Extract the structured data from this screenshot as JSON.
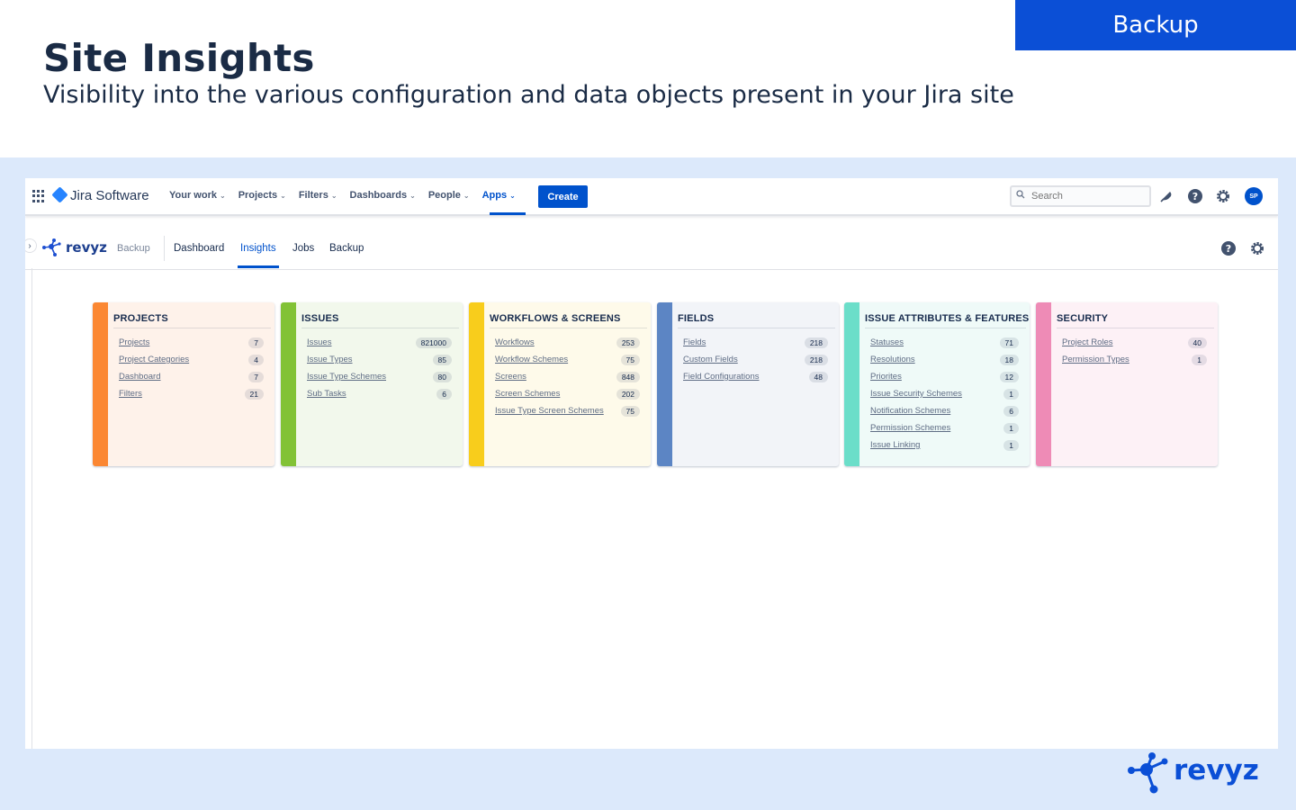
{
  "slide": {
    "title": "Site Insights",
    "subtitle": "Visibility into the various configuration and data objects present in your Jira site",
    "badge": "Backup",
    "brand": "revyz"
  },
  "colors": {
    "accent_blue": "#0b4fd6",
    "jira_blue": "#0052cc",
    "band": "#dce9fb"
  },
  "jira_nav": {
    "product": "Jira Software",
    "items": [
      {
        "label": "Your work"
      },
      {
        "label": "Projects"
      },
      {
        "label": "Filters"
      },
      {
        "label": "Dashboards"
      },
      {
        "label": "People"
      },
      {
        "label": "Apps"
      }
    ],
    "create_label": "Create",
    "search_placeholder": "Search",
    "avatar_initials": "SP",
    "icons": [
      "app-switcher-icon",
      "notifications-icon",
      "help-icon",
      "settings-icon"
    ]
  },
  "app_nav": {
    "logo_text": "revyz",
    "app_label": "Backup",
    "tabs": [
      {
        "label": "Dashboard"
      },
      {
        "label": "Insights"
      },
      {
        "label": "Jobs"
      },
      {
        "label": "Backup"
      }
    ],
    "active_tab": "Insights",
    "icons": [
      "help-icon",
      "settings-icon"
    ]
  },
  "cards": [
    {
      "title": "PROJECTS",
      "color": "#fb8732",
      "bg": "#fef2ea",
      "items": [
        {
          "label": "Projects",
          "count": "7"
        },
        {
          "label": "Project Categories",
          "count": "4"
        },
        {
          "label": "Dashboard",
          "count": "7"
        },
        {
          "label": "Filters",
          "count": "21"
        }
      ]
    },
    {
      "title": "ISSUES",
      "color": "#82c236",
      "bg": "#f2f8ec",
      "items": [
        {
          "label": "Issues",
          "count": "821000"
        },
        {
          "label": "Issue Types",
          "count": "85"
        },
        {
          "label": "Issue Type Schemes",
          "count": "80"
        },
        {
          "label": "Sub Tasks",
          "count": "6"
        }
      ]
    },
    {
      "title": "WORKFLOWS & SCREENS",
      "color": "#f8cd1c",
      "bg": "#fefaea",
      "items": [
        {
          "label": "Workflows",
          "count": "253"
        },
        {
          "label": "Workflow Schemes",
          "count": "75"
        },
        {
          "label": "Screens",
          "count": "848"
        },
        {
          "label": "Screen Schemes",
          "count": "202"
        },
        {
          "label": "Issue Type Screen Schemes",
          "count": "75"
        }
      ]
    },
    {
      "title": "FIELDS",
      "color": "#5c85c4",
      "bg": "#f2f4f8",
      "items": [
        {
          "label": "Fields",
          "count": "218"
        },
        {
          "label": "Custom Fields",
          "count": "218"
        },
        {
          "label": "Field Configurations",
          "count": "48"
        }
      ]
    },
    {
      "title": "ISSUE ATTRIBUTES & FEATURES",
      "color": "#6bdec9",
      "bg": "#effaf8",
      "items": [
        {
          "label": "Statuses",
          "count": "71"
        },
        {
          "label": "Resolutions",
          "count": "18"
        },
        {
          "label": "Priorites",
          "count": "12"
        },
        {
          "label": "Issue Security Schemes",
          "count": "1"
        },
        {
          "label": "Notification Schemes",
          "count": "6"
        },
        {
          "label": "Permission Schemes",
          "count": "1"
        },
        {
          "label": "Issue Linking",
          "count": "1"
        }
      ]
    },
    {
      "title": "SECURITY",
      "color": "#ee8bb6",
      "bg": "#fdf1f6",
      "items": [
        {
          "label": "Project Roles",
          "count": "40"
        },
        {
          "label": "Permission Types",
          "count": "1"
        }
      ]
    }
  ]
}
